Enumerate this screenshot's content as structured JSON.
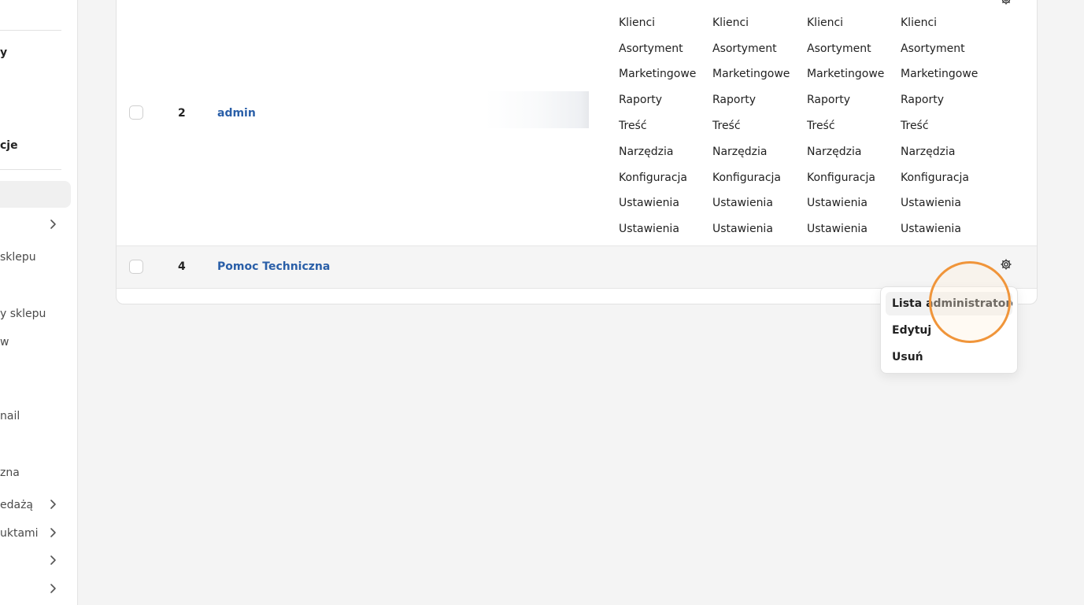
{
  "sidebar": {
    "items": [
      {
        "label": "y",
        "bold": true
      },
      {
        "label": "cje",
        "bold": true
      },
      {
        "label": "sklepu"
      },
      {
        "label": "y sklepu"
      },
      {
        "label": "w"
      },
      {
        "label": "nail"
      },
      {
        "label": "zna"
      },
      {
        "label": "edażą"
      },
      {
        "label": "uktami"
      }
    ]
  },
  "table": {
    "rows": [
      {
        "id": "2",
        "name": "admin"
      },
      {
        "id": "4",
        "name": "Pomoc Techniczna"
      }
    ],
    "permission_columns": [
      [
        "Klienci",
        "Asortyment",
        "Marketingowe",
        "Raporty",
        "Treść",
        "Narzędzia",
        "Konfiguracja",
        "Ustawienia",
        "Ustawienia"
      ],
      [
        "Klienci",
        "Asortyment",
        "Marketingowe",
        "Raporty",
        "Treść",
        "Narzędzia",
        "Konfiguracja",
        "Ustawienia",
        "Ustawienia"
      ],
      [
        "Klienci",
        "Asortyment",
        "Marketingowe",
        "Raporty",
        "Treść",
        "Narzędzia",
        "Konfiguracja",
        "Ustawienia",
        "Ustawienia"
      ],
      [
        "Klienci",
        "Asortyment",
        "Marketingowe",
        "Raporty",
        "Treść",
        "Narzędzia",
        "Konfiguracja",
        "Ustawienia",
        "Ustawienia"
      ]
    ]
  },
  "dropdown": {
    "items": [
      "Lista administratorów",
      "Edytuj",
      "Usuń"
    ]
  },
  "icons": {
    "row_actions": "gear-icon",
    "submenu": "chevron-right-icon"
  },
  "colors": {
    "link": "#2a5fa8",
    "focus_ring": "#f0953a"
  }
}
